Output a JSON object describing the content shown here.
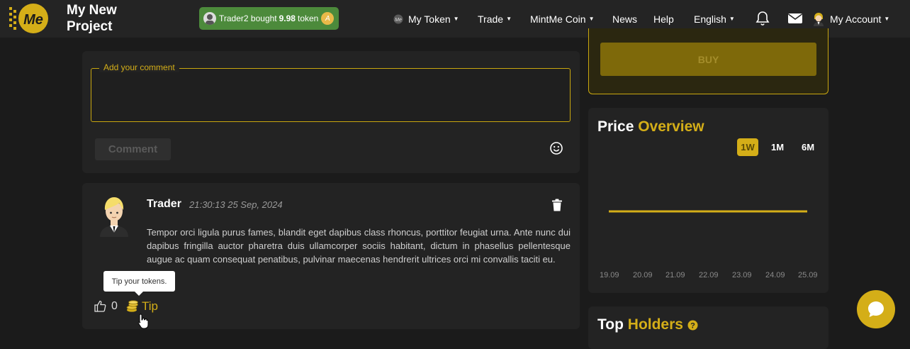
{
  "brand": {
    "project_line1": "My New",
    "project_line2": "Project"
  },
  "ticker": {
    "user": "Trader2",
    "verb": "bought",
    "amount": "9.98",
    "unit": "token",
    "coin_letter": "A"
  },
  "nav": {
    "my_token": "My Token",
    "trade": "Trade",
    "mintme_coin": "MintMe Coin",
    "news": "News",
    "help": "Help",
    "language": "English",
    "my_account": "My Account"
  },
  "comment_form": {
    "legend": "Add your comment",
    "submit_label": "Comment"
  },
  "comment": {
    "author": "Trader",
    "timestamp": "21:30:13 25 Sep, 2024",
    "text": "Tempor orci ligula purus fames, blandit eget dapibus class rhoncus, porttitor feugiat urna. Ante nunc dui dapibus fringilla auctor pharetra duis ullamcorper sociis habitant, dictum in phasellus pellentesque augue ac quam consequat penatibus, pulvinar maecenas hendrerit ultrices orci mi convallis taciti eu.",
    "likes": "0",
    "tip_label": "Tip",
    "tip_tooltip": "Tip your tokens."
  },
  "trade_panel": {
    "buy_label": "BUY"
  },
  "price_overview": {
    "title_white": "Price",
    "title_accent": "Overview",
    "ranges": [
      "1W",
      "1M",
      "6M"
    ],
    "active_range": "1W"
  },
  "chart_data": {
    "type": "line",
    "x": [
      "19.09",
      "20.09",
      "21.09",
      "22.09",
      "23.09",
      "24.09",
      "25.09"
    ],
    "series": [
      {
        "values": [
          1,
          1,
          1,
          1,
          1,
          1,
          1
        ]
      }
    ],
    "title": "",
    "xlabel": "",
    "ylabel": "",
    "grid": false,
    "line_color": "#d4ae18"
  },
  "top_holders": {
    "title_white": "Top",
    "title_accent": "Holders"
  },
  "colors": {
    "accent": "#d4ae18",
    "ticker_green": "#4c8a3b",
    "background": "#1b1b1b",
    "card": "#232323"
  },
  "icons": {
    "logo": "mintme-logo-icon",
    "token": "token-icon",
    "bell": "bell-icon",
    "mail": "mail-icon",
    "account": "account-avatar-icon",
    "emoji": "emoji-icon",
    "trash": "trash-icon",
    "like": "thumbs-up-icon",
    "tip": "coins-icon",
    "help": "help-icon",
    "chat": "chat-icon"
  }
}
